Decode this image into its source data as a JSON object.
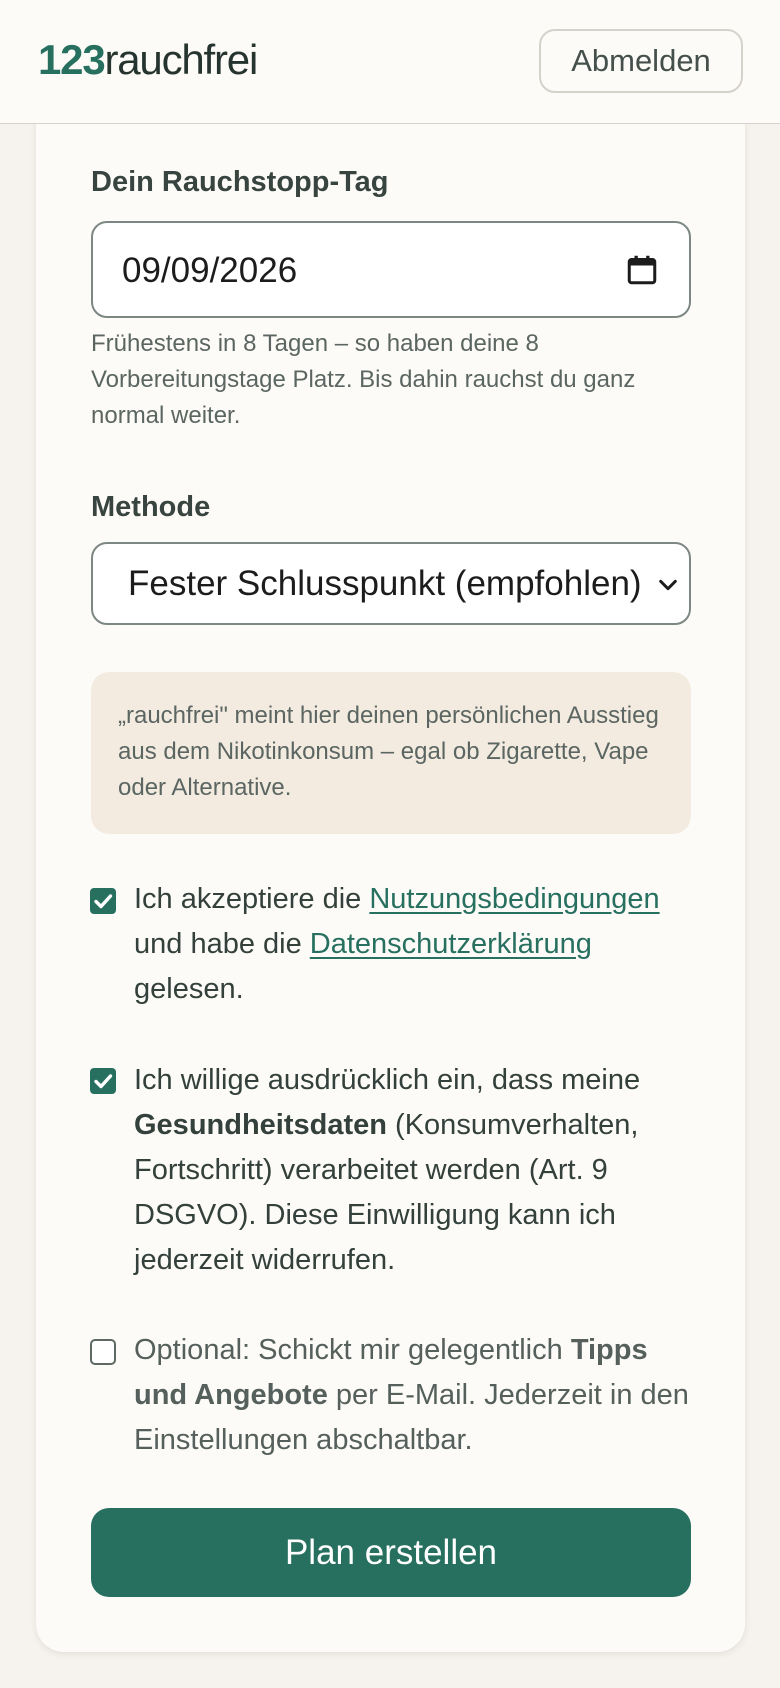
{
  "header": {
    "logo_number": "123",
    "logo_text": "rauchfrei",
    "logout_label": "Abmelden"
  },
  "form": {
    "date_label": "Dein Rauchstopp-Tag",
    "date_value": "09/09/2026",
    "date_hint": "Frühestens in 8 Tagen – so haben deine 8 Vorbereitungstage Platz. Bis dahin rauchst du ganz normal weiter.",
    "method_label": "Methode",
    "method_selected": "Fester Schlusspunkt (empfohlen)",
    "info_text": "„rauchfrei\" meint hier deinen persönlichen Ausstieg aus dem Nikotinkonsum – egal ob Zigarette, Vape oder Alternative.",
    "consent_terms": {
      "checked": true,
      "pre": "Ich akzeptiere die ",
      "terms_link": "Nutzungsbedingungen",
      "mid": " und habe die ",
      "privacy_link": "Datenschutzerklärung",
      "post": " gelesen."
    },
    "consent_health": {
      "checked": true,
      "pre": "Ich willige ausdrücklich ein, dass meine ",
      "bold": "Gesundheitsdaten",
      "post": " (Konsumverhalten, Fortschritt) verarbeitet werden (Art. 9 DSGVO). Diese Einwilligung kann ich jederzeit widerrufen."
    },
    "consent_marketing": {
      "checked": false,
      "pre": "Optional: Schickt mir gelegentlich ",
      "bold": "Tipps und Angebote",
      "post": " per E-Mail. Jederzeit in den Einstellungen abschaltbar."
    },
    "submit_label": "Plan erstellen"
  },
  "icons": {
    "calendar": "calendar-icon",
    "select_chevron": "chevron-down-icon",
    "checkmark": "checkmark-icon"
  },
  "colors": {
    "accent": "#27705f",
    "background": "#f6f3ee",
    "card": "#fdfbf8",
    "info_box": "#f3ebe0"
  }
}
